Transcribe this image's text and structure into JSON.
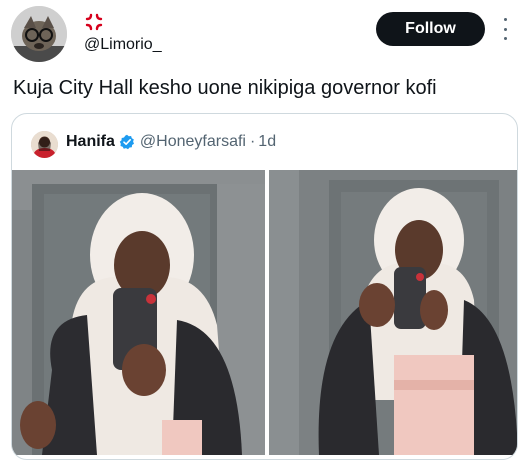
{
  "post": {
    "handle": "@Limorio_",
    "text": "Kuja City Hall kesho uone nikipiga governor kofi",
    "follow_label": "Follow"
  },
  "quoted": {
    "name": "Hanifa",
    "handle": "@Honeyfarsafi",
    "separator": "·",
    "time": "1d"
  },
  "colors": {
    "follow_bg": "#0f1419",
    "verified": "#1d9bf0",
    "name_emoji": "#d6001c",
    "secondary_text": "#536471"
  },
  "icons": {
    "display_name_emoji": "anger-symbol-icon",
    "verified": "verified-badge-icon",
    "more": "more-options-icon"
  }
}
